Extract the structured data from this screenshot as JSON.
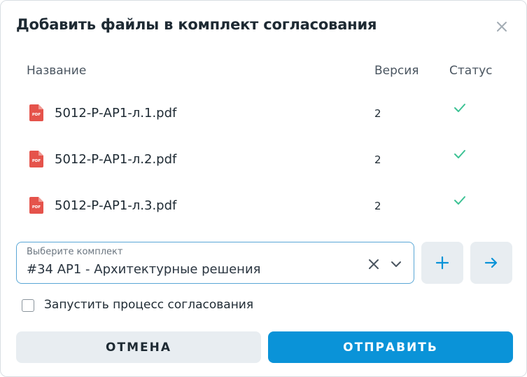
{
  "dialog": {
    "title": "Добавить файлы в комплект согласования",
    "close_icon": "close-icon"
  },
  "table": {
    "headers": {
      "name": "Название",
      "version": "Версия",
      "status": "Статус"
    },
    "rows": [
      {
        "file": "5012-Р-АР1-л.1.pdf",
        "version": "2",
        "status": "check-icon"
      },
      {
        "file": "5012-Р-АР1-л.2.pdf",
        "version": "2",
        "status": "check-icon"
      },
      {
        "file": "5012-Р-АР1-л.3.pdf",
        "version": "2",
        "status": "check-icon"
      }
    ],
    "file_icon": "pdf-file-icon",
    "file_icon_text": "PDF"
  },
  "select": {
    "label": "Выберите комплект",
    "value": "#34 АР1 - Архитектурные решения",
    "clear_icon": "clear-icon",
    "dropdown_icon": "chevron-down-icon"
  },
  "actions": {
    "add_icon": "plus-icon",
    "go_icon": "arrow-right-icon"
  },
  "checkbox": {
    "label": "Запустить процесс согласования",
    "checked": false
  },
  "footer": {
    "cancel_label": "ОТМЕНА",
    "submit_label": "ОТПРАВИТЬ"
  },
  "colors": {
    "primary": "#0a93d8",
    "success": "#3cc294",
    "pdf": "#e5534b",
    "secondary_button": "#e8edf1",
    "focus_border": "#5aa7d6"
  }
}
